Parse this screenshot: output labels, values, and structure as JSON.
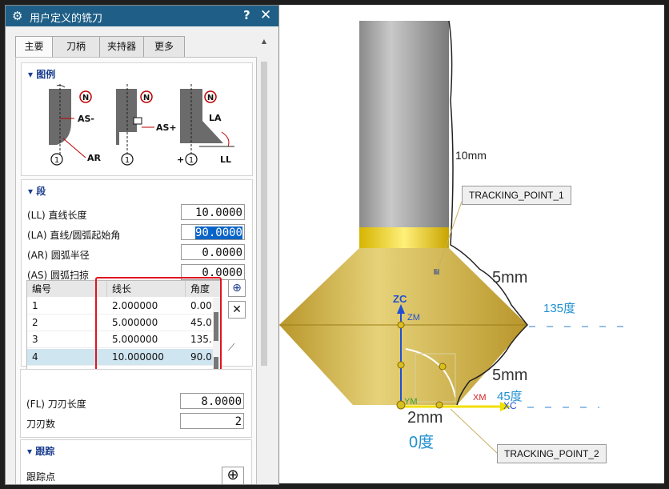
{
  "dialog": {
    "title": "用户定义的铣刀",
    "help": "?",
    "close": "✕",
    "tabs": [
      "主要",
      "刀柄",
      "夹持器",
      "更多"
    ]
  },
  "legend": {
    "title": "图例",
    "labels": {
      "n": "N",
      "one": "1",
      "as_minus": "AS-",
      "as_plus": "AS+",
      "ar": "AR",
      "la": "LA",
      "ll": "LL",
      "plus": "+"
    }
  },
  "segment": {
    "title": "段",
    "fields": [
      {
        "label": "(LL) 直线长度",
        "value": "10.0000"
      },
      {
        "label": "(LA) 直线/圆弧起始角",
        "value": "90.0000"
      },
      {
        "label": "(AR) 圆弧半径",
        "value": "0.0000"
      },
      {
        "label": "(AS) 圆弧扫掠",
        "value": "0.0000"
      }
    ],
    "table": {
      "headers": [
        "编号",
        "线长",
        "角度"
      ],
      "rows": [
        {
          "id": "1",
          "length": "2.000000",
          "angle": "0.00"
        },
        {
          "id": "2",
          "length": "5.000000",
          "angle": "45.0"
        },
        {
          "id": "3",
          "length": "5.000000",
          "angle": "135."
        },
        {
          "id": "4",
          "length": "10.000000",
          "angle": "90.0"
        }
      ],
      "selected_row": 4
    }
  },
  "flute": {
    "length_label": "(FL) 刀刃长度",
    "length_value": "8.0000",
    "count_label": "刀刃数",
    "count_value": "2"
  },
  "tracking": {
    "title": "跟踪",
    "point_label": "跟踪点"
  },
  "viewport": {
    "dim_10mm": "10mm",
    "dim_5mm_top": "5mm",
    "dim_135": "135度",
    "dim_5mm_bottom": "5mm",
    "dim_45": "45度",
    "dim_2mm": "2mm",
    "dim_0": "0度",
    "tracking_point_1": "TRACKING_POINT_1",
    "tracking_point_2": "TRACKING_POINT_2",
    "axes": {
      "zc": "ZC",
      "zm": "ZM",
      "xm": "XM",
      "xc": "XC",
      "ym": "YM"
    }
  },
  "colors": {
    "titlebar": "#1f5f87",
    "tool_gold": "#d4b32a",
    "shank_gray": "#9a9a9a",
    "highlight_red": "#e0141e",
    "dim_blue": "#1e8fd0"
  }
}
